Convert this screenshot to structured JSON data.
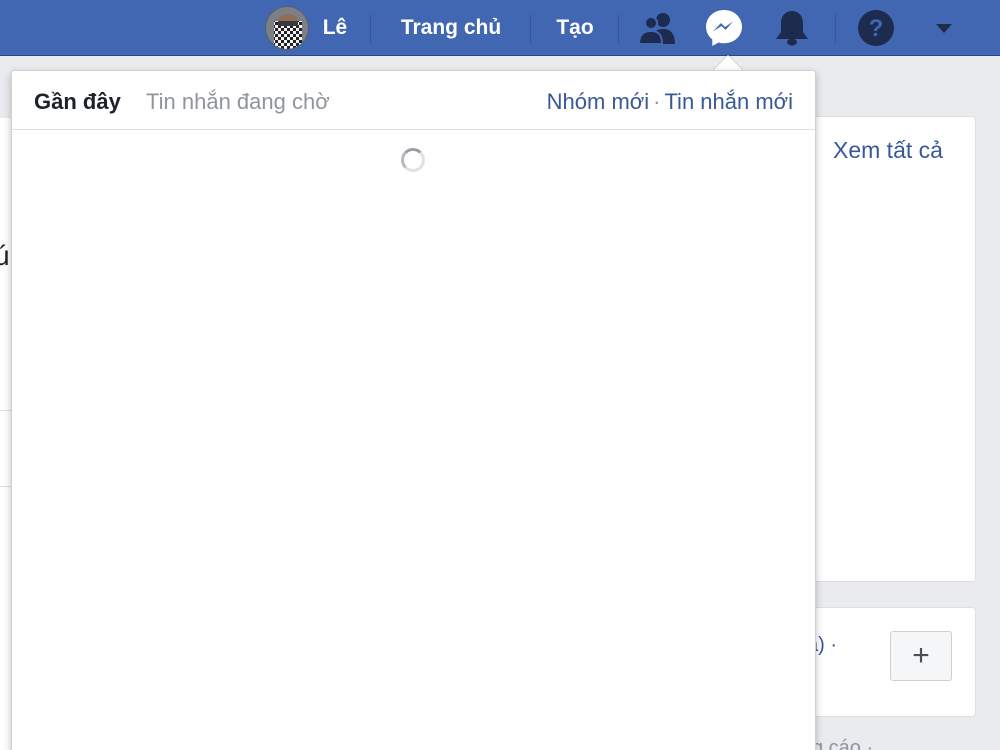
{
  "topbar": {
    "user_name": "Lê",
    "home_label": "Trang chủ",
    "create_label": "Tạo",
    "icons": [
      "friends-icon",
      "messenger-icon",
      "notifications-icon",
      "help-icon",
      "account-menu-icon"
    ]
  },
  "messenger_dropdown": {
    "tab_recent": "Gần đây",
    "tab_pending": "Tin nhắn đang chờ",
    "new_group": "Nhóm mới",
    "separator": "·",
    "new_message": "Tin nhắn mới",
    "state": "loading"
  },
  "background": {
    "see_all": "Xem tất cả",
    "left_fragment": "ú",
    "fragment_1": "ả) ·",
    "fragment_2": "g cáo ·",
    "add_button": "+"
  },
  "colors": {
    "topbar": "#4267b2",
    "link": "#385898",
    "page_bg": "#e9ebee"
  }
}
